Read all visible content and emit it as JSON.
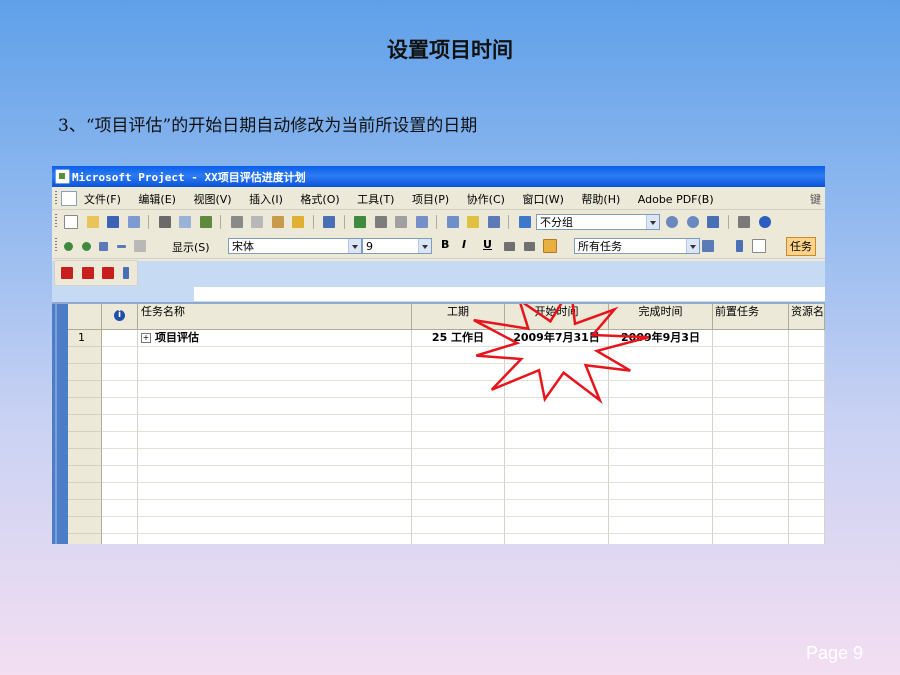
{
  "slide": {
    "title": "设置项目时间",
    "subtitle": "3、“项目评估”的开始日期自动修改为当前所设置的日期",
    "page": "Page 9"
  },
  "window": {
    "title": "Microsoft Project - XX项目评估进度计划",
    "menu": [
      "文件(F)",
      "编辑(E)",
      "视图(V)",
      "插入(I)",
      "格式(O)",
      "工具(T)",
      "项目(P)",
      "协作(C)",
      "窗口(W)",
      "帮助(H)",
      "Adobe PDF(B)"
    ],
    "menu_right": "键",
    "toolbar1": {
      "group_combo": "不分组"
    },
    "toolbar2": {
      "show_label": "显示(S)",
      "font_combo": "宋体",
      "size_combo": "9",
      "bold": "B",
      "italic": "I",
      "underline": "U",
      "filter_combo": "所有任务",
      "task_button": "任务"
    }
  },
  "grid": {
    "headers": {
      "task_name": "任务名称",
      "duration": "工期",
      "start": "开始时间",
      "finish": "完成时间",
      "predecessors": "前置任务",
      "resources": "资源名"
    },
    "rows": [
      {
        "id": "1",
        "name": "项目评估",
        "duration": "25 工作日",
        "start": "2009年7月31日",
        "finish": "2009年9月3日"
      }
    ]
  },
  "colors": {
    "highlight_star": "#e8141b",
    "title_bar": "#0a5ee8"
  }
}
